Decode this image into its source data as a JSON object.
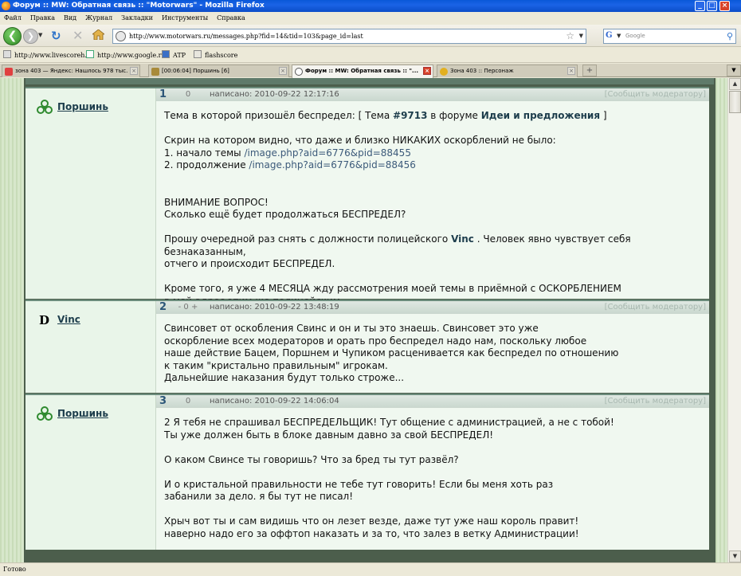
{
  "window": {
    "title": "Форум :: MW: Обратная связь :: \"Motorwars\" - Mozilla Firefox",
    "min": "_",
    "max": "□",
    "close": "×"
  },
  "menu": [
    "Файл",
    "Правка",
    "Вид",
    "Журнал",
    "Закладки",
    "Инструменты",
    "Справка"
  ],
  "nav": {
    "url": "http://www.motorwars.ru/messages.php?fid=14&tid=103&page_id=last",
    "search_placeholder": "Google",
    "back": "❮",
    "fwd": "❯",
    "reload": "↻",
    "stop": "✕"
  },
  "bookmarks": [
    "http://www.livescoreh...",
    "http://www.google.ru/",
    "ATP",
    "flashscore"
  ],
  "tabs": [
    {
      "label": "зона 403 — Яндекс: Нашлось 978 тыс. ..."
    },
    {
      "label": "[00:06:04] Поршинь [6]"
    },
    {
      "label": "Форум :: MW: Обратная связь :: \"...",
      "active": true
    },
    {
      "label": "Зона 403 :: Персонаж"
    }
  ],
  "posts": [
    {
      "num": "1",
      "vote": "0",
      "date": "написано: 2010-09-22 12:17:16",
      "report": "[Сообщить модератору]",
      "author": "Поршинь",
      "author_icon": "biohazard-icon",
      "l1a": "Тема в которой призошёл беспредел: [ Тема ",
      "l1b": "#9713",
      "l1c": " в форуме ",
      "l1d": "Идеи и предложения",
      "l1e": " ]",
      "l2": "Скрин на котором видно, что даже и близко НИКАКИХ оскорблений не было:",
      "l3a": "1. начало темы ",
      "l3b": "/image.php?aid=6776&pid=88455",
      "l4a": "2. продолжение ",
      "l4b": "/image.php?aid=6776&pid=88456",
      "l5": "ВНИМАНИЕ ВОПРОС!",
      "l6": "Сколько ещё будет продолжаться БЕСПРЕДЕЛ?",
      "l7a": "Прошу очередной раз снять с должности полицейского ",
      "l7b": "Vinc",
      "l7c": " . Человек явно чувствует себя безнаказанным,",
      "l8": "отчего и происходит БЕСПРЕДЕЛ.",
      "l9": "Кроме того, я уже 4 МЕСЯЦА жду рассмотрения моей темы в приёмной с ОСКОРБЛЕНИЕМ",
      "l10": "в мой адрес этим же полицейским."
    },
    {
      "num": "2",
      "vote": "- 0 +",
      "date": "написано: 2010-09-22 13:48:19",
      "report": "[Сообщить модератору]",
      "author": "Vinc",
      "author_icon": "D",
      "l1": "Свинсовет от оскобления Свинс и он и ты это знаешь. Свинсовет это уже",
      "l2": "оскорбление всех модераторов и орать про беспредел надо нам, поскольку любое",
      "l3": "наше действие Бацем, Поршнем и Чупиком расценивается как беспредел по отношению",
      "l4": "к таким \"кристально правильным\" игрокам.",
      "l5": "Дальнейшие наказания будут только строже..."
    },
    {
      "num": "3",
      "vote": "0",
      "date": "написано: 2010-09-22 14:06:04",
      "report": "[Сообщить модератору]",
      "author": "Поршинь",
      "author_icon": "biohazard-icon",
      "l1": "2 Я тебя не спрашивал БЕСПРЕДЕЛЬЩИК! Тут общение с администрацией, а не с тобой!",
      "l2": "Ты уже должен быть в блоке давным давно за свой БЕСПРЕДЕЛ!",
      "l3": "О каком Свинсе ты говоришь? Что за бред ты тут развёл?",
      "l4": "И о кристальной правильности не тебе тут говорить! Если бы меня хоть раз",
      "l5": "забанили за дело. я бы тут не писал!",
      "l6": "Хрыч вот ты и сам видишь что он лезет везде, даже тут уже наш король правит!",
      "l7": "наверно надо его за оффтоп наказать и за то, что залез в ветку Администрации!"
    }
  ],
  "status": "Готово"
}
